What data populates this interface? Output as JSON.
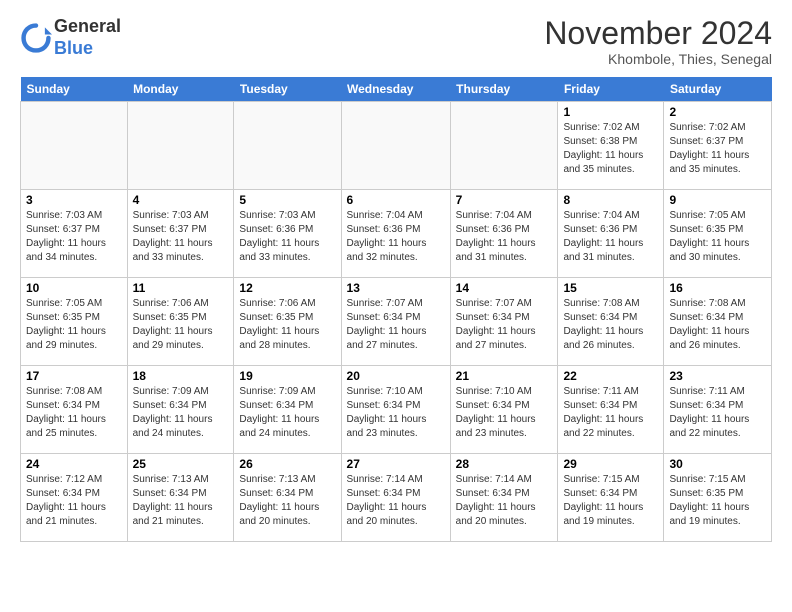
{
  "header": {
    "logo_general": "General",
    "logo_blue": "Blue",
    "month_title": "November 2024",
    "location": "Khombole, Thies, Senegal"
  },
  "weekdays": [
    "Sunday",
    "Monday",
    "Tuesday",
    "Wednesday",
    "Thursday",
    "Friday",
    "Saturday"
  ],
  "weeks": [
    [
      {
        "day": "",
        "info": ""
      },
      {
        "day": "",
        "info": ""
      },
      {
        "day": "",
        "info": ""
      },
      {
        "day": "",
        "info": ""
      },
      {
        "day": "",
        "info": ""
      },
      {
        "day": "1",
        "info": "Sunrise: 7:02 AM\nSunset: 6:38 PM\nDaylight: 11 hours and 35 minutes."
      },
      {
        "day": "2",
        "info": "Sunrise: 7:02 AM\nSunset: 6:37 PM\nDaylight: 11 hours and 35 minutes."
      }
    ],
    [
      {
        "day": "3",
        "info": "Sunrise: 7:03 AM\nSunset: 6:37 PM\nDaylight: 11 hours and 34 minutes."
      },
      {
        "day": "4",
        "info": "Sunrise: 7:03 AM\nSunset: 6:37 PM\nDaylight: 11 hours and 33 minutes."
      },
      {
        "day": "5",
        "info": "Sunrise: 7:03 AM\nSunset: 6:36 PM\nDaylight: 11 hours and 33 minutes."
      },
      {
        "day": "6",
        "info": "Sunrise: 7:04 AM\nSunset: 6:36 PM\nDaylight: 11 hours and 32 minutes."
      },
      {
        "day": "7",
        "info": "Sunrise: 7:04 AM\nSunset: 6:36 PM\nDaylight: 11 hours and 31 minutes."
      },
      {
        "day": "8",
        "info": "Sunrise: 7:04 AM\nSunset: 6:36 PM\nDaylight: 11 hours and 31 minutes."
      },
      {
        "day": "9",
        "info": "Sunrise: 7:05 AM\nSunset: 6:35 PM\nDaylight: 11 hours and 30 minutes."
      }
    ],
    [
      {
        "day": "10",
        "info": "Sunrise: 7:05 AM\nSunset: 6:35 PM\nDaylight: 11 hours and 29 minutes."
      },
      {
        "day": "11",
        "info": "Sunrise: 7:06 AM\nSunset: 6:35 PM\nDaylight: 11 hours and 29 minutes."
      },
      {
        "day": "12",
        "info": "Sunrise: 7:06 AM\nSunset: 6:35 PM\nDaylight: 11 hours and 28 minutes."
      },
      {
        "day": "13",
        "info": "Sunrise: 7:07 AM\nSunset: 6:34 PM\nDaylight: 11 hours and 27 minutes."
      },
      {
        "day": "14",
        "info": "Sunrise: 7:07 AM\nSunset: 6:34 PM\nDaylight: 11 hours and 27 minutes."
      },
      {
        "day": "15",
        "info": "Sunrise: 7:08 AM\nSunset: 6:34 PM\nDaylight: 11 hours and 26 minutes."
      },
      {
        "day": "16",
        "info": "Sunrise: 7:08 AM\nSunset: 6:34 PM\nDaylight: 11 hours and 26 minutes."
      }
    ],
    [
      {
        "day": "17",
        "info": "Sunrise: 7:08 AM\nSunset: 6:34 PM\nDaylight: 11 hours and 25 minutes."
      },
      {
        "day": "18",
        "info": "Sunrise: 7:09 AM\nSunset: 6:34 PM\nDaylight: 11 hours and 24 minutes."
      },
      {
        "day": "19",
        "info": "Sunrise: 7:09 AM\nSunset: 6:34 PM\nDaylight: 11 hours and 24 minutes."
      },
      {
        "day": "20",
        "info": "Sunrise: 7:10 AM\nSunset: 6:34 PM\nDaylight: 11 hours and 23 minutes."
      },
      {
        "day": "21",
        "info": "Sunrise: 7:10 AM\nSunset: 6:34 PM\nDaylight: 11 hours and 23 minutes."
      },
      {
        "day": "22",
        "info": "Sunrise: 7:11 AM\nSunset: 6:34 PM\nDaylight: 11 hours and 22 minutes."
      },
      {
        "day": "23",
        "info": "Sunrise: 7:11 AM\nSunset: 6:34 PM\nDaylight: 11 hours and 22 minutes."
      }
    ],
    [
      {
        "day": "24",
        "info": "Sunrise: 7:12 AM\nSunset: 6:34 PM\nDaylight: 11 hours and 21 minutes."
      },
      {
        "day": "25",
        "info": "Sunrise: 7:13 AM\nSunset: 6:34 PM\nDaylight: 11 hours and 21 minutes."
      },
      {
        "day": "26",
        "info": "Sunrise: 7:13 AM\nSunset: 6:34 PM\nDaylight: 11 hours and 20 minutes."
      },
      {
        "day": "27",
        "info": "Sunrise: 7:14 AM\nSunset: 6:34 PM\nDaylight: 11 hours and 20 minutes."
      },
      {
        "day": "28",
        "info": "Sunrise: 7:14 AM\nSunset: 6:34 PM\nDaylight: 11 hours and 20 minutes."
      },
      {
        "day": "29",
        "info": "Sunrise: 7:15 AM\nSunset: 6:34 PM\nDaylight: 11 hours and 19 minutes."
      },
      {
        "day": "30",
        "info": "Sunrise: 7:15 AM\nSunset: 6:35 PM\nDaylight: 11 hours and 19 minutes."
      }
    ]
  ]
}
